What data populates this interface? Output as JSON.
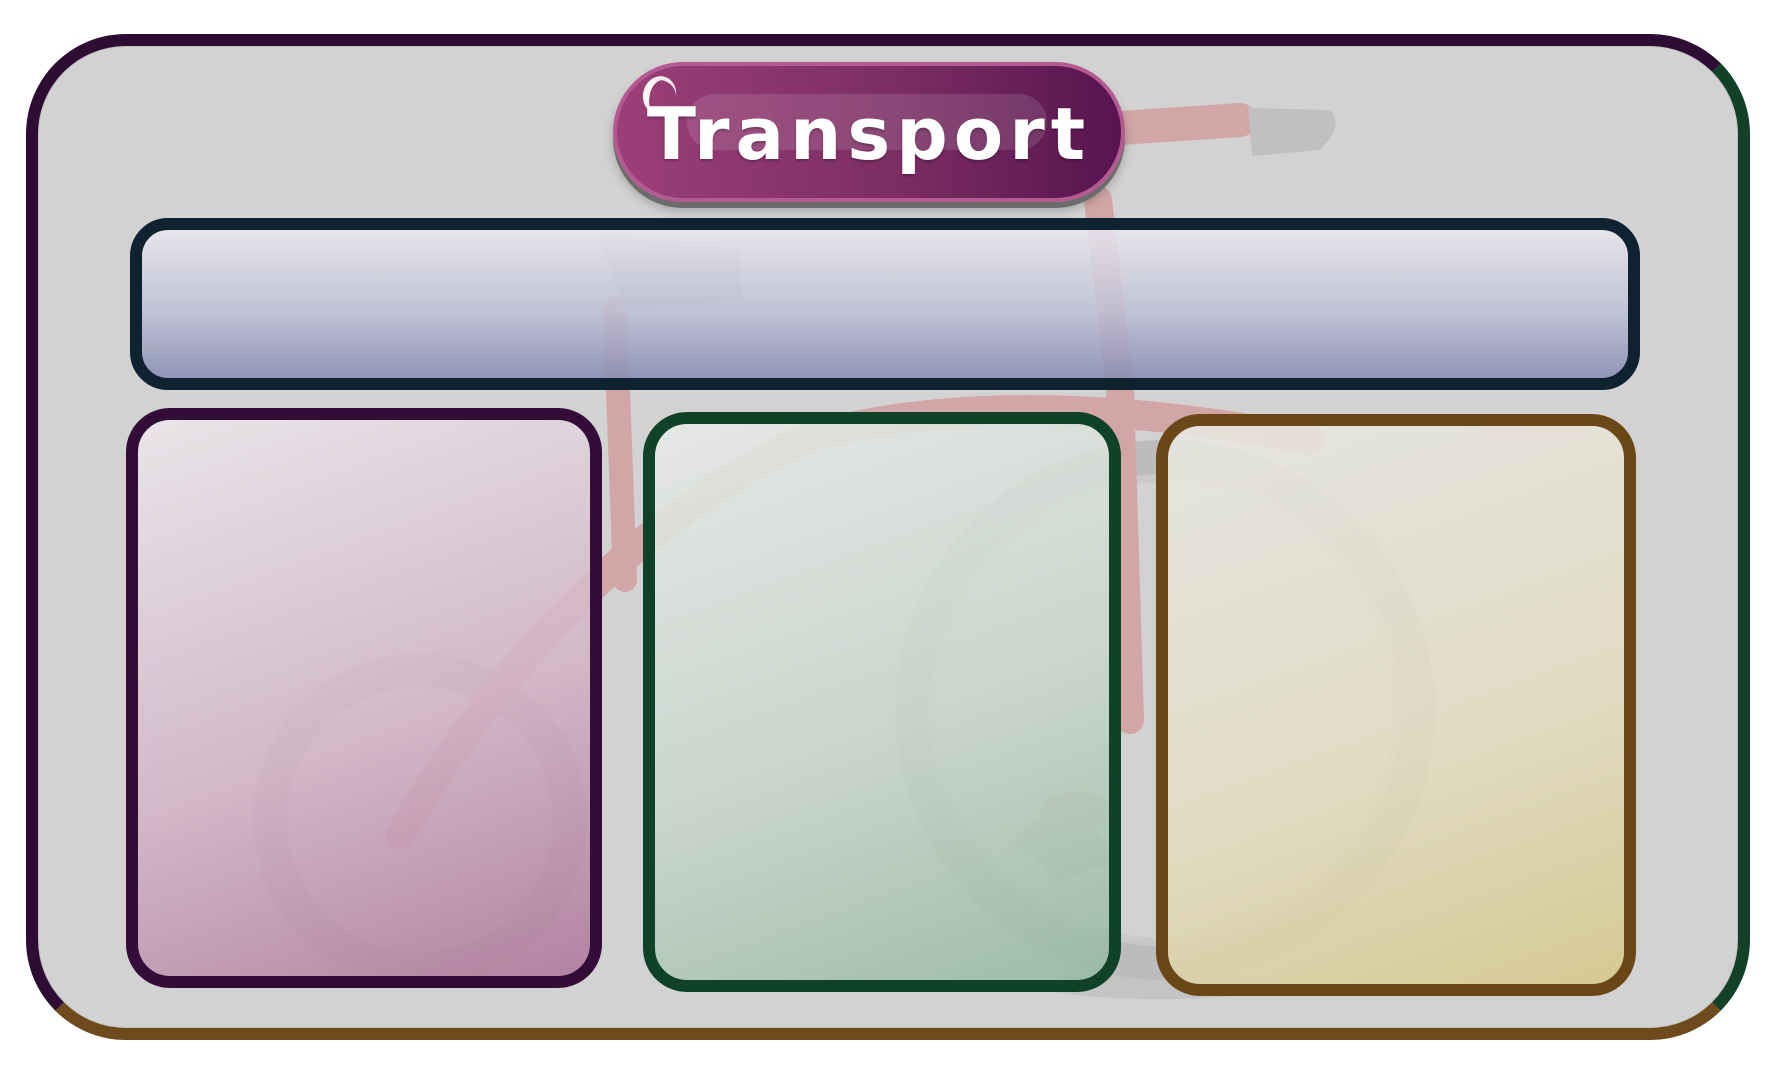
{
  "poster": {
    "title": "Transport",
    "background_image": "faded-bicycle-illustration"
  },
  "colors": {
    "board_background": "#d2d2d2",
    "title_pill": "#7b2e63",
    "header_bar_border": "#0f2230",
    "left_box_border": "#330c38",
    "middle_box_border": "#0f4228",
    "right_box_border": "#6b4718",
    "bike_frame": "#c96b6b",
    "bike_tire": "#b5b5b5"
  },
  "header_bar": {
    "text": ""
  },
  "boxes": [
    {
      "label": "",
      "accent": "#330c38"
    },
    {
      "label": "",
      "accent": "#0f4228"
    },
    {
      "label": "",
      "accent": "#6b4718"
    }
  ]
}
